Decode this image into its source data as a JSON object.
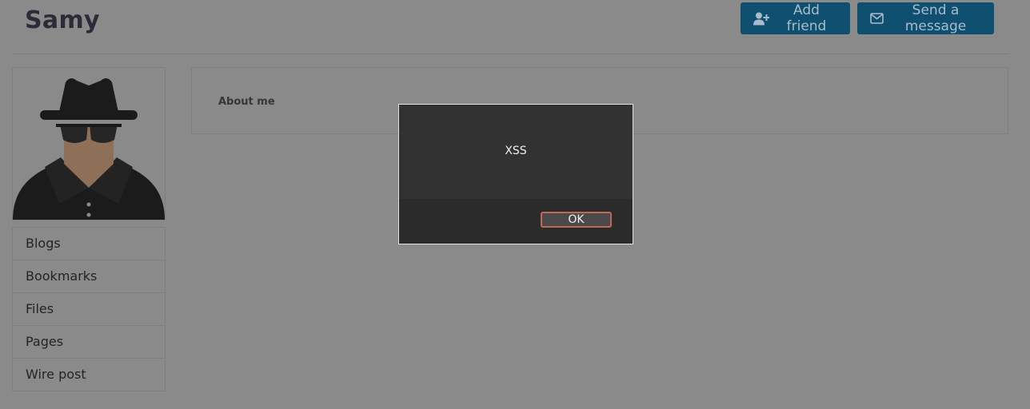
{
  "profile": {
    "name": "Samy"
  },
  "header": {
    "actions": [
      {
        "label": "Add friend",
        "icon": "user-plus-icon"
      },
      {
        "label": "Send a message",
        "icon": "envelope-icon"
      }
    ]
  },
  "sidebar": {
    "avatar": "incognito-avatar",
    "items": [
      {
        "label": "Blogs"
      },
      {
        "label": "Bookmarks"
      },
      {
        "label": "Files"
      },
      {
        "label": "Pages"
      },
      {
        "label": "Wire post"
      }
    ]
  },
  "about": {
    "label": "About me"
  },
  "alert": {
    "message": "XSS",
    "ok_label": "OK"
  },
  "colors": {
    "overlay_background": "#8a8a8a",
    "button_background": "#0f5070",
    "dialog_background": "#323232",
    "dialog_footer": "#2b2b2b",
    "ok_border": "#c1685b"
  }
}
